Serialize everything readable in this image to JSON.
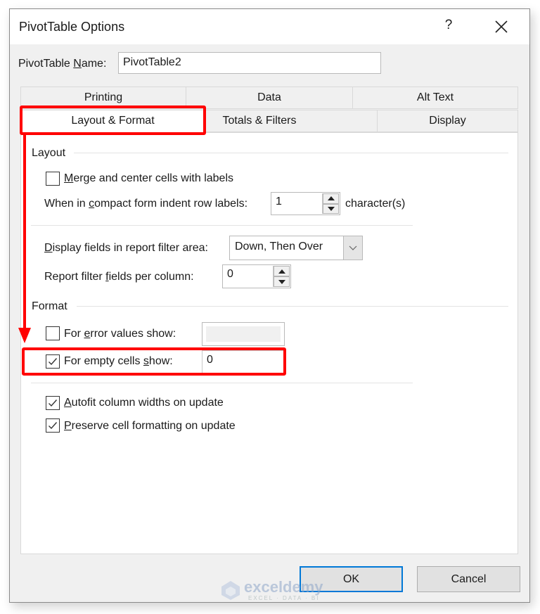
{
  "dialog": {
    "title": "PivotTable Options",
    "help_label": "?",
    "close_label": "✕"
  },
  "name_field": {
    "label_prefix": "PivotTable ",
    "label_mnemonic": "N",
    "label_suffix": "ame:",
    "value": "PivotTable2"
  },
  "tabs": {
    "row1": [
      {
        "label": "Printing",
        "active": false
      },
      {
        "label": "Data",
        "active": false
      },
      {
        "label": "Alt Text",
        "active": false
      }
    ],
    "row2": [
      {
        "label": "Layout & Format",
        "active": true
      },
      {
        "label": "Totals & Filters",
        "active": false
      },
      {
        "label": "Display",
        "active": false
      }
    ]
  },
  "layout_group": {
    "title": "Layout",
    "merge_center": {
      "mn": "M",
      "rest": "erge and center cells with labels",
      "checked": false
    },
    "indent": {
      "pre": "When in ",
      "mn": "c",
      "rest": "ompact form indent row labels:",
      "value": "1",
      "suffix": "character(s)"
    },
    "display_fields": {
      "mn": "D",
      "rest": "isplay fields in report filter area:",
      "value": "Down, Then Over"
    },
    "filter_fields": {
      "pre": "Report filter ",
      "mn": "f",
      "rest": "ields per column:",
      "value": "0"
    }
  },
  "format_group": {
    "title": "Format",
    "error_values": {
      "pre": "For ",
      "mn": "e",
      "rest": "rror values show:",
      "checked": false,
      "value": ""
    },
    "empty_cells": {
      "pre": "For empty cells ",
      "mn": "s",
      "rest": "how:",
      "checked": true,
      "value": "0"
    },
    "autofit": {
      "mn": "A",
      "rest": "utofit column widths on update",
      "checked": true
    },
    "preserve": {
      "mn": "P",
      "rest": "reserve cell formatting on update",
      "checked": true
    }
  },
  "buttons": {
    "ok": "OK",
    "cancel": "Cancel"
  },
  "watermark": {
    "brand": "exceldemy",
    "tagline": "EXCEL · DATA · BI"
  },
  "colors": {
    "annotation": "#ff0000",
    "default_button_border": "#0078d7"
  }
}
